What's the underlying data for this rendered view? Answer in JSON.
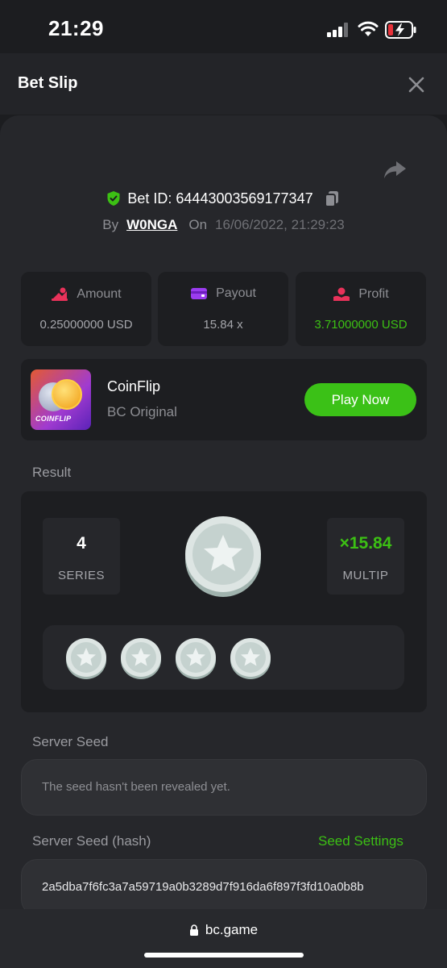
{
  "status_bar": {
    "time": "21:29"
  },
  "header": {
    "title": "Bet Slip"
  },
  "bet": {
    "id_label": "Bet ID: 64443003569177347",
    "by_label": "By",
    "user": "W0NGA",
    "on_label": "On",
    "date": "16/06/2022, 21:29:23"
  },
  "stats": {
    "amount": {
      "label": "Amount",
      "value": "0.25000000 USD"
    },
    "payout": {
      "label": "Payout",
      "value": "15.84 x"
    },
    "profit": {
      "label": "Profit",
      "value": "3.71000000 USD"
    }
  },
  "game": {
    "thumb_label": "COINFLIP",
    "name": "CoinFlip",
    "provider": "BC Original",
    "play_label": "Play Now"
  },
  "result": {
    "label": "Result",
    "series_value": "4",
    "series_label": "SERIES",
    "multiplier_value": "×15.84",
    "multiplier_label": "MULTIP",
    "coin_count": 4
  },
  "seed": {
    "server_label": "Server Seed",
    "server_text": "The seed hasn't been revealed yet.",
    "hash_label": "Server Seed (hash)",
    "settings_label": "Seed Settings",
    "hash_value": "2a5dba7f6fc3a7a59719a0b3289d7f916da6f897f3fd10a0b8b"
  },
  "browser": {
    "url": "bc.game"
  },
  "colors": {
    "accent_green": "#3cc014",
    "button_green": "#3bc117",
    "background": "#1c1d20",
    "card": "#1d1e21"
  }
}
